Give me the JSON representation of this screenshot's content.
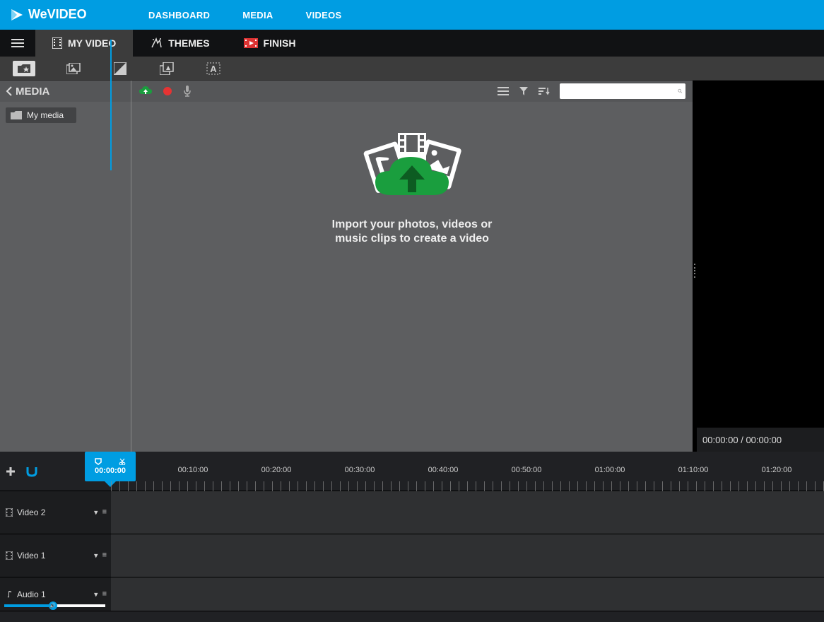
{
  "brand": "WeVIDEO",
  "topnav": [
    "DASHBOARD",
    "MEDIA",
    "VIDEOS"
  ],
  "tabs": {
    "myvideo": "MY VIDEO",
    "themes": "THEMES",
    "finish": "FINISH"
  },
  "media_hdr": "MEDIA",
  "folder": "My media",
  "search_placeholder": "",
  "drop_msg_l1": "Import your photos, videos or",
  "drop_msg_l2": "music clips to create a video",
  "preview_time": "00:00:00 / 00:00:00",
  "playhead_time": "00:00:00",
  "ruler": [
    "00:10:00",
    "00:20:00",
    "00:30:00",
    "00:40:00",
    "00:50:00",
    "01:00:00",
    "01:10:00",
    "01:20:00"
  ],
  "tracks": {
    "video2": "Video 2",
    "video1": "Video 1",
    "audio1": "Audio 1"
  }
}
